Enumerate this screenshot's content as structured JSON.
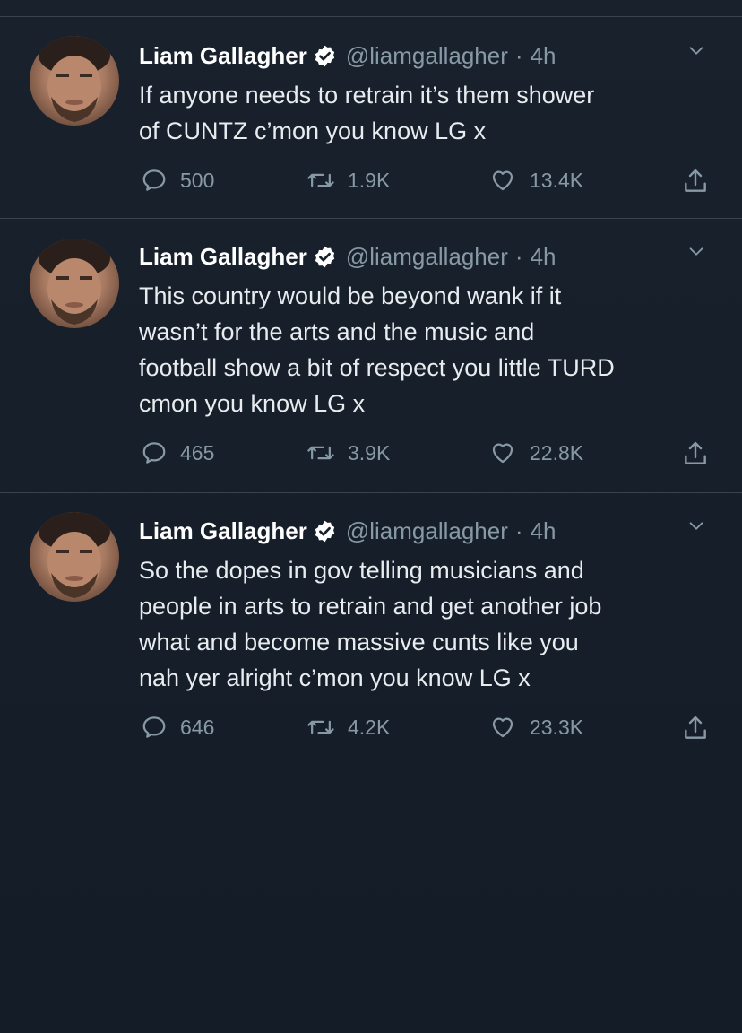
{
  "colors": {
    "background": "#15202b",
    "text": "#e8ecef",
    "muted": "#8899a6",
    "verified": "#ffffff",
    "divider": "#38444d"
  },
  "tweets": [
    {
      "name": "Liam Gallagher",
      "handle": "@liamgallagher",
      "time": "4h",
      "text_lines": [
        "If anyone needs to retrain it’s them shower",
        "of CUNTZ c’mon you know LG x"
      ],
      "replies": "500",
      "retweets": "1.9K",
      "likes": "13.4K"
    },
    {
      "name": "Liam Gallagher",
      "handle": "@liamgallagher",
      "time": "4h",
      "text_lines": [
        "This country would be beyond wank if it",
        "wasn’t for the arts and the music and",
        "football show a bit of respect you little TURD",
        "cmon you know LG x"
      ],
      "replies": "465",
      "retweets": "3.9K",
      "likes": "22.8K"
    },
    {
      "name": "Liam Gallagher",
      "handle": "@liamgallagher",
      "time": "4h",
      "text_lines": [
        "So the dopes in gov telling musicians and",
        "people in arts to retrain and get another job",
        "what and become massive cunts like you",
        "nah yer alright c’mon you know LG x"
      ],
      "replies": "646",
      "retweets": "4.2K",
      "likes": "23.3K"
    }
  ],
  "icons": {
    "reply": "reply-icon",
    "retweet": "retweet-icon",
    "like": "heart-icon",
    "share": "share-icon",
    "verified": "verified-badge-icon",
    "more": "chevron-down-icon"
  }
}
